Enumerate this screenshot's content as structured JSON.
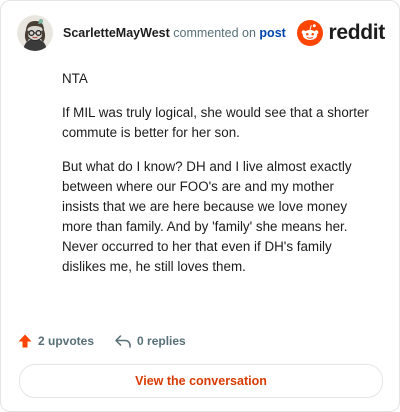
{
  "header": {
    "username": "ScarletteMayWest",
    "action_text": "commented on",
    "post_link": "post",
    "brand": "reddit"
  },
  "comment": {
    "paragraphs": [
      "NTA",
      "If MIL was truly logical, she would see that a shorter commute is better for her son.",
      "But what do I know? DH and I live almost exactly between where our FOO's are and my mother insists that we are here because we love money more than family. And by 'family' she means her. Never occurred to her that even if DH's family dislikes me, he still loves them."
    ]
  },
  "stats": {
    "upvotes": "2 upvotes",
    "replies": "0 replies"
  },
  "actions": {
    "view_conversation": "View the conversation"
  },
  "colors": {
    "upvote": "#ff4500",
    "link": "#0045ac",
    "cta": "#d93a00",
    "brand": "#ff4500"
  },
  "icons": {
    "avatar": "snoo-avatar-icon",
    "brand": "reddit-logo-icon",
    "upvote": "upvote-arrow-icon",
    "reply": "reply-arrow-icon"
  }
}
